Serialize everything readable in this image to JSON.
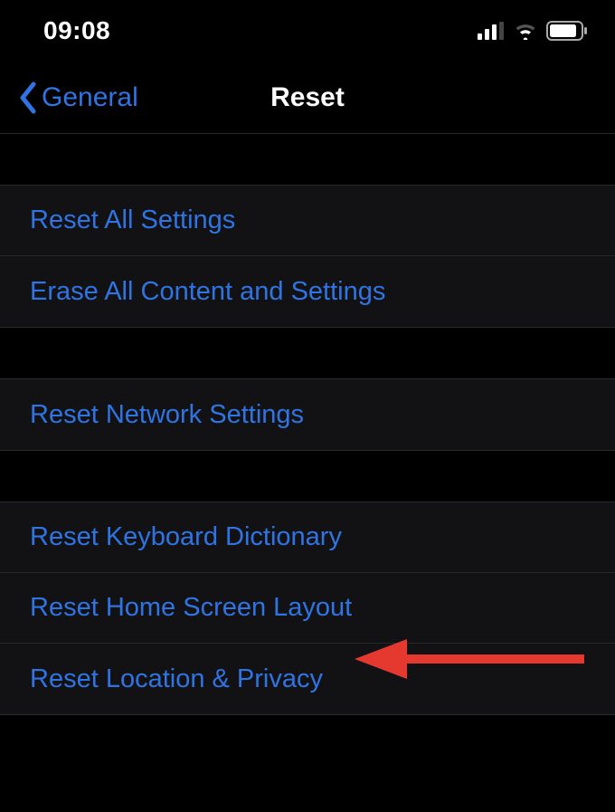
{
  "statusBar": {
    "time": "09:08"
  },
  "nav": {
    "backLabel": "General",
    "title": "Reset"
  },
  "sections": [
    {
      "items": [
        {
          "label": "Reset All Settings",
          "name": "reset-all-settings-item"
        },
        {
          "label": "Erase All Content and Settings",
          "name": "erase-all-content-item"
        }
      ]
    },
    {
      "items": [
        {
          "label": "Reset Network Settings",
          "name": "reset-network-settings-item"
        }
      ]
    },
    {
      "items": [
        {
          "label": "Reset Keyboard Dictionary",
          "name": "reset-keyboard-dictionary-item"
        },
        {
          "label": "Reset Home Screen Layout",
          "name": "reset-home-screen-item"
        },
        {
          "label": "Reset Location & Privacy",
          "name": "reset-location-privacy-item"
        }
      ]
    }
  ]
}
